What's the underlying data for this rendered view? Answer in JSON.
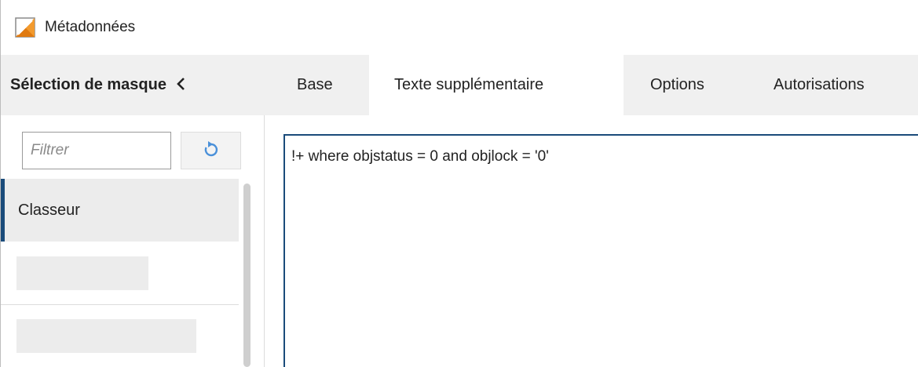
{
  "window": {
    "title": "Métadonnées",
    "icon": "metadata-app-icon"
  },
  "mask_panel": {
    "title": "Sélection de masque",
    "collapse_icon": "chevron-left-icon",
    "filter_placeholder": "Filtrer",
    "filter_value": "",
    "reset_icon": "refresh-icon",
    "items": [
      {
        "label": "Classeur",
        "selected": true
      },
      {
        "label": "",
        "selected": false
      },
      {
        "label": "",
        "selected": false
      }
    ]
  },
  "tabs": [
    {
      "label": "Base",
      "active": false
    },
    {
      "label": "Texte supplémentaire",
      "active": true
    },
    {
      "label": "Options",
      "active": false
    },
    {
      "label": "Autorisations",
      "active": false
    }
  ],
  "editor": {
    "content": "!+ where objstatus = 0 and objlock = '0'"
  },
  "colors": {
    "accent": "#1a4b7a",
    "header_bg": "#f0f0f0",
    "selected_bg": "#ececec",
    "reset_icon": "#4a90d9"
  }
}
